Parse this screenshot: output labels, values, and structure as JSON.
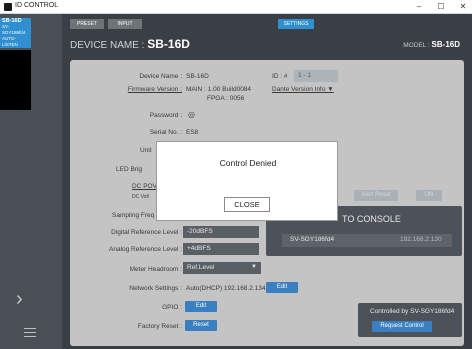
{
  "window": {
    "title": "ID CONTROL",
    "minimize": "–",
    "maximize": "☐",
    "close": "✕"
  },
  "sidebar": {
    "device_card": {
      "name": "SB-16D",
      "lines": [
        "SB-16D",
        "SV-SGY186fd4",
        "AUTO-LISTEN"
      ]
    },
    "nav_arrow": "›"
  },
  "tabs": [
    {
      "label": "PRESET"
    },
    {
      "label": "INPUT"
    },
    {
      "label": "SETTINGS"
    }
  ],
  "header": {
    "device_name_label": "DEVICE NAME :",
    "device_name": "SB-16D",
    "model_label": "MODEL :",
    "model": "SB-16D"
  },
  "settings": {
    "device_name_label": "Device Name :",
    "device_name": "SB-16D",
    "id_label": "ID : #",
    "id_value": "1 - 1",
    "firmware_label": "Firmware Version :",
    "firmware_main": "MAIN : 1.00 Build0084",
    "firmware_fpga": "FPGA : 0056",
    "dante_label": "Dante Version Info ▼",
    "password_label": "Password :",
    "serial_label": "Serial No. :",
    "serial_value": "ES8",
    "unit_label": "Unit",
    "led_label": "LED Brig",
    "dc_power_label": "DC POV",
    "dc_volt_label": "DC Volt",
    "sampling_label": "Sampling Freq",
    "digital_ref_label": "Digital Reference Level :",
    "digital_ref_value": "-20dBFS",
    "analog_ref_label": "Analog Reference Level :",
    "analog_ref_value": "+4dBFS",
    "meter_label": "Meter Headroom :",
    "meter_value": "Ref.Level",
    "network_label": "Network Settings :",
    "network_value": "Auto(DHCP) 192.168.2.134",
    "network_edit": "Edit",
    "gpio_label": "GPIO :",
    "gpio_edit": "Edit",
    "factory_label": "Factory Reset :",
    "factory_reset": "Reset",
    "alert_reset": "Alert Reset",
    "on_label": "ON"
  },
  "console": {
    "title": "TO CONSOLE",
    "name": "SV-SGY186fd4",
    "ip": "192.168.2.130"
  },
  "control": {
    "controlled_by": "Controlled by SV-SGY186fd4",
    "request": "Request Control"
  },
  "modal": {
    "title": "Control Denied",
    "close": "CLOSE"
  },
  "colors": {
    "accent": "#2f8fd0",
    "panel": "#c4c4c4",
    "dark": "#3a3f45"
  }
}
